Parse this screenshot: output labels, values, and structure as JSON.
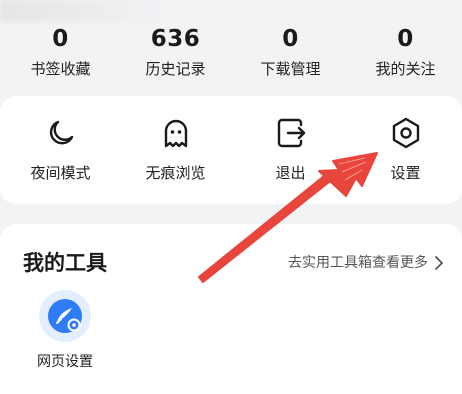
{
  "stats": [
    {
      "count": "0",
      "label": "书签收藏"
    },
    {
      "count": "636",
      "label": "历史记录"
    },
    {
      "count": "0",
      "label": "下载管理"
    },
    {
      "count": "0",
      "label": "我的关注"
    }
  ],
  "actions": [
    {
      "label": "夜间模式",
      "icon": "moon-icon"
    },
    {
      "label": "无痕浏览",
      "icon": "ghost-icon"
    },
    {
      "label": "退出",
      "icon": "exit-icon"
    },
    {
      "label": "设置",
      "icon": "settings-hexagon-icon"
    }
  ],
  "tools": {
    "title": "我的工具",
    "more_label": "去实用工具箱查看更多",
    "items": [
      {
        "label": "网页设置",
        "icon": "web-settings-icon"
      }
    ]
  },
  "colors": {
    "background": "#f2f3f5",
    "card": "#ffffff",
    "annotation_arrow": "#e8453c",
    "tool_icon_blue": "#2f7cf6"
  }
}
